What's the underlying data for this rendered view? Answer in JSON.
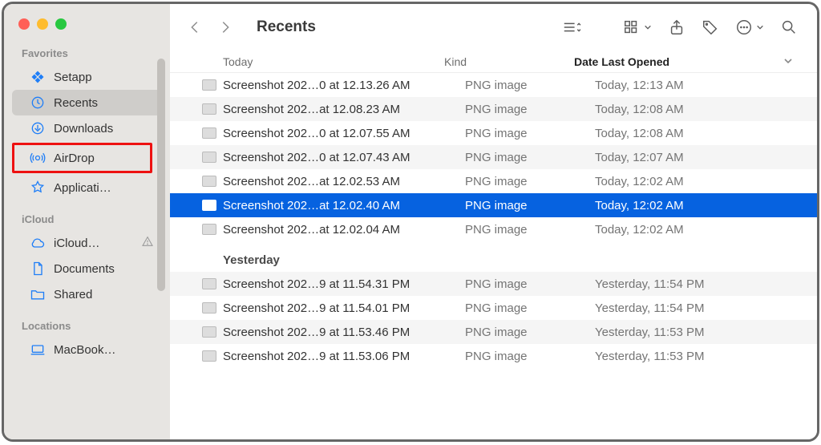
{
  "window": {
    "title": "Recents"
  },
  "sidebar": {
    "sections": [
      {
        "label": "Favorites",
        "items": [
          {
            "icon": "setapp",
            "label": "Setapp",
            "active": false
          },
          {
            "icon": "clock",
            "label": "Recents",
            "active": true
          },
          {
            "icon": "download",
            "label": "Downloads",
            "active": false
          },
          {
            "icon": "airdrop",
            "label": "AirDrop",
            "active": false,
            "highlight": true
          },
          {
            "icon": "apps",
            "label": "Applicati…",
            "active": false
          }
        ]
      },
      {
        "label": "iCloud",
        "items": [
          {
            "icon": "cloud",
            "label": "iCloud…",
            "warn": true
          },
          {
            "icon": "doc",
            "label": "Documents"
          },
          {
            "icon": "shared",
            "label": "Shared"
          }
        ]
      },
      {
        "label": "Locations",
        "items": [
          {
            "icon": "laptop",
            "label": "MacBook…"
          }
        ]
      }
    ]
  },
  "columns": {
    "name": "",
    "kind": "Kind",
    "date": "Date Last Opened"
  },
  "groups": [
    {
      "label": "Today",
      "rows": [
        {
          "name": "Screenshot 202…0 at 12.13.26 AM",
          "kind": "PNG image",
          "date": "Today, 12:13 AM"
        },
        {
          "name": "Screenshot 202…at 12.08.23 AM",
          "kind": "PNG image",
          "date": "Today, 12:08 AM"
        },
        {
          "name": "Screenshot 202…0 at 12.07.55 AM",
          "kind": "PNG image",
          "date": "Today, 12:08 AM"
        },
        {
          "name": "Screenshot 202…0 at 12.07.43 AM",
          "kind": "PNG image",
          "date": "Today, 12:07 AM"
        },
        {
          "name": "Screenshot 202…at 12.02.53 AM",
          "kind": "PNG image",
          "date": "Today, 12:02 AM"
        },
        {
          "name": "Screenshot 202…at 12.02.40 AM",
          "kind": "PNG image",
          "date": "Today, 12:02 AM",
          "selected": true
        },
        {
          "name": "Screenshot 202…at 12.02.04 AM",
          "kind": "PNG image",
          "date": "Today, 12:02 AM"
        }
      ]
    },
    {
      "label": "Yesterday",
      "rows": [
        {
          "name": "Screenshot 202…9 at 11.54.31 PM",
          "kind": "PNG image",
          "date": "Yesterday, 11:54 PM"
        },
        {
          "name": "Screenshot 202…9 at 11.54.01 PM",
          "kind": "PNG image",
          "date": "Yesterday, 11:54 PM"
        },
        {
          "name": "Screenshot 202…9 at 11.53.46 PM",
          "kind": "PNG image",
          "date": "Yesterday, 11:53 PM"
        },
        {
          "name": "Screenshot 202…9 at 11.53.06 PM",
          "kind": "PNG image",
          "date": "Yesterday, 11:53 PM"
        }
      ]
    }
  ]
}
